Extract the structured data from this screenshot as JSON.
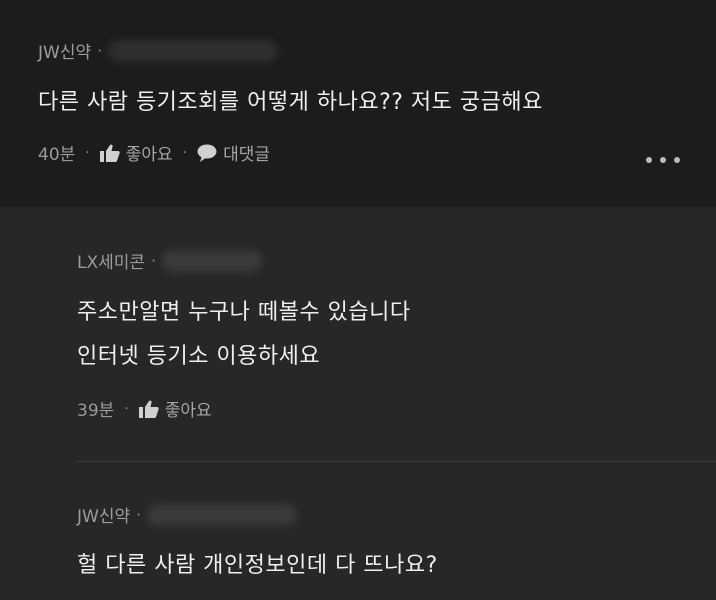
{
  "comments": [
    {
      "author": "JW신약",
      "text": "다른 사람 등기조회를 어떻게 하나요?? 저도 궁금해요",
      "time": "40분",
      "like_label": "좋아요",
      "reply_label": "대댓글"
    }
  ],
  "replies": [
    {
      "author": "LX세미콘",
      "lines": [
        "주소만알면 누구나 떼볼수 있습니다",
        "인터넷 등기소 이용하세요"
      ],
      "time": "39분",
      "like_label": "좋아요"
    },
    {
      "author": "JW신약",
      "lines": [
        "헐 다른 사람 개인정보인데 다 뜨나요?"
      ]
    }
  ],
  "separator": "·",
  "icons": {
    "like": "thumbs-up-icon",
    "reply": "speech-bubble-icon",
    "more": "more-dots-icon"
  },
  "colors": {
    "top_bg": "#1c1c1c",
    "reply_bg": "#272727",
    "text": "#efefef",
    "meta": "#9a9a9a"
  }
}
